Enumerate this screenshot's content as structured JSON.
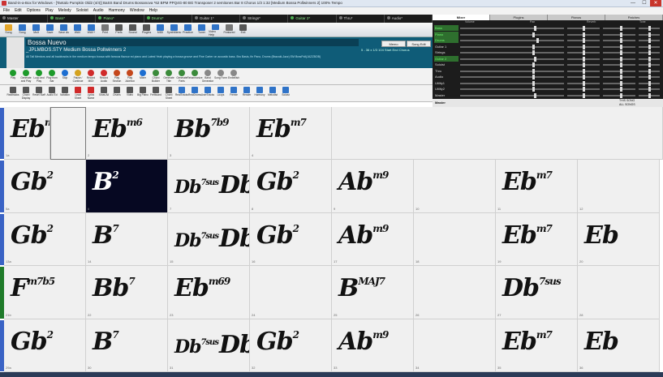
{
  "window": {
    "title": "Band-in-a-Box for Windows - [Tantalo Pumpkin Old2 (4/4)] BaSS Band Drums Bossanova *62 BPM PPQ4G-80 BG Transposer 2 semitones Bar 8 Chorus 1/3  1:32  [Medium Bossa Pollwinners 2] 100% Tempo",
    "min": "—",
    "max": "☐",
    "close": "✕"
  },
  "menu": [
    "File",
    "Edit",
    "Options",
    "Play",
    "Melody",
    "Soloist",
    "Audio",
    "Harmony",
    "Window",
    "Help"
  ],
  "tracks": [
    {
      "label": "Master",
      "on": false
    },
    {
      "label": "Bass*",
      "on": true
    },
    {
      "label": "Piano*",
      "on": true
    },
    {
      "label": "Drums*",
      "on": true
    },
    {
      "label": "Guitar 1*",
      "on": false
    },
    {
      "label": "Strings*",
      "on": false
    },
    {
      "label": "Guitar 2*",
      "on": true
    },
    {
      "label": "Thru*",
      "on": false
    },
    {
      "label": "Audio*",
      "on": false
    }
  ],
  "toolbar": [
    {
      "label": "Song",
      "color": "#e4a62b"
    },
    {
      "label": "Song",
      "color": "#2f73c8"
    },
    {
      "label": "Mult",
      "color": "#2f73c8"
    },
    {
      "label": "Save",
      "color": "#2f73c8"
    },
    {
      "label": "Save As",
      "color": "#2f73c8"
    },
    {
      "label": "WAV",
      "color": "#2f73c8"
    },
    {
      "label": "WAV+",
      "color": "#2f73c8"
    },
    {
      "label": "Print",
      "color": "#777777"
    },
    {
      "label": "Prefs",
      "color": "#555555"
    },
    {
      "label": "Sound",
      "color": "#555555"
    },
    {
      "label": "Plugins",
      "color": "#555555"
    },
    {
      "label": "MIDI",
      "color": "#2f73c8"
    },
    {
      "label": "SynthMenu",
      "color": "#2f73c8"
    },
    {
      "label": "Practice",
      "color": "#2f73c8"
    },
    {
      "label": "Tuner",
      "color": "#2f73c8"
    },
    {
      "label": "Video Help",
      "color": "#2f73c8"
    },
    {
      "label": "Featured",
      "color": "#777777"
    },
    {
      "label": "Exit",
      "color": "#555555"
    }
  ],
  "song": {
    "title": "Bossa Nuevo",
    "style": "_JPLMBOS.STY Medium Bossa Pollwinners 2",
    "memo": "All Tall Mentors and all backtracks in the medium tempo bossa with famous flavour ed piano and Latest Yeah playing a bossa groove and Fine Carter on acoustic bass.   Bru Basis, fin Pano, Drums (Brazuki-Jazz) EM BrasPoll(JAZZBOB)",
    "counters": "5 - 36 x 1/3  104  Start End Chorus",
    "side1": "Memo",
    "side2": "Song Edit"
  },
  "controls_row1": [
    {
      "label": "Play",
      "color": "#1d9a2a"
    },
    {
      "label": "Generate and Play",
      "color": "#1d9a2a"
    },
    {
      "label": "Loop and Play",
      "color": "#1d9a2a"
    },
    {
      "label": "Play from Bar",
      "color": "#1d9a2a"
    },
    {
      "label": "Stop",
      "color": "#1d6ed1"
    },
    {
      "label": "Pause / Continue",
      "color": "#d4a21f"
    },
    {
      "label": "Record MIDI",
      "color": "#d02a2a"
    },
    {
      "label": "Record Audio",
      "color": "#d02a2a"
    },
    {
      "label": "Play Section",
      "color": "#c4471c"
    },
    {
      "label": "Play Jukebox",
      "color": "#c4471c"
    },
    {
      "label": "Mixer",
      "color": "#1d6ed1"
    },
    {
      "label": "Chord Builder",
      "color": "#3a8a3a"
    },
    {
      "label": "Generate Title",
      "color": "#3a8a3a"
    },
    {
      "label": "Generate Parts",
      "color": "#3a8a3a"
    },
    {
      "label": "Reharmonize",
      "color": "#3a8a3a"
    },
    {
      "label": "Band Generator",
      "color": "#888888"
    },
    {
      "label": "Song Form",
      "color": "#888888"
    },
    {
      "label": "Embellish",
      "color": "#888888"
    }
  ],
  "controls_row2": [
    {
      "label": "Realtracks",
      "color": "#555555"
    },
    {
      "label": "Chord Display",
      "color": "#555555"
    },
    {
      "label": "Reset Staff",
      "color": "#555555"
    },
    {
      "label": "Audio Ed",
      "color": "#555555"
    },
    {
      "label": "Notation",
      "color": "#555555"
    },
    {
      "label": "Lead Sheet",
      "color": "#d02a2a"
    },
    {
      "label": "Lyrics Name",
      "color": "#d02a2a"
    },
    {
      "label": "Show All",
      "color": "#555555"
    },
    {
      "label": "Drums",
      "color": "#555555"
    },
    {
      "label": "Video",
      "color": "#555555"
    },
    {
      "label": "Big Piano",
      "color": "#555555"
    },
    {
      "label": "Fretboard",
      "color": "#555555"
    },
    {
      "label": "Chord Sheet",
      "color": "#555555"
    },
    {
      "label": "RealTracks",
      "color": "#2f73c8"
    },
    {
      "label": "RealDrums",
      "color": "#2f73c8"
    },
    {
      "label": "UserTracks",
      "color": "#2f73c8"
    },
    {
      "label": "Loops",
      "color": "#2f73c8"
    },
    {
      "label": "Freeze",
      "color": "#2f73c8"
    },
    {
      "label": "Render",
      "color": "#2f73c8"
    },
    {
      "label": "Harmony",
      "color": "#2f73c8"
    },
    {
      "label": "Melodist",
      "color": "#2f73c8"
    },
    {
      "label": "Soloist",
      "color": "#2f73c8"
    }
  ],
  "mixer": {
    "tabs": [
      "Mixer",
      "Plugins",
      "Pianos",
      "Patches"
    ],
    "headers": [
      "Volume",
      "Pan",
      "Reverb",
      "Tone"
    ],
    "channels": [
      {
        "name": "Bass",
        "hi": true,
        "vol": 0.72,
        "pan": 0.5,
        "rev": 0.55,
        "tone": 0.5
      },
      {
        "name": "Piano",
        "hi": true,
        "vol": 0.7,
        "pan": 0.5,
        "rev": 0.55,
        "tone": 0.5
      },
      {
        "name": "Drums",
        "hi": true,
        "vol": 0.74,
        "pan": 0.5,
        "rev": 0.55,
        "tone": 0.5
      },
      {
        "name": "Guitar 1",
        "hi": false,
        "vol": 0.7,
        "pan": 0.5,
        "rev": 0.55,
        "tone": 0.5
      },
      {
        "name": "Strings",
        "hi": false,
        "vol": 0.7,
        "pan": 0.5,
        "rev": 0.55,
        "tone": 0.5
      },
      {
        "name": "Guitar 2",
        "hi": true,
        "vol": 0.72,
        "pan": 0.5,
        "rev": 0.55,
        "tone": 0.5
      },
      {
        "name": "Soloist",
        "hi": false,
        "vol": 0.7,
        "pan": 0.5,
        "rev": 0.55,
        "tone": 0.5
      },
      {
        "name": "Thru",
        "hi": false,
        "vol": 0.7,
        "pan": 0.5,
        "rev": 0.55,
        "tone": 0.5
      },
      {
        "name": "Audio",
        "hi": false,
        "vol": 0.7,
        "pan": 0.5,
        "rev": 0.55,
        "tone": 0.5
      },
      {
        "name": "Utility1",
        "hi": false,
        "vol": 0.7,
        "pan": 0.5,
        "rev": 0.55,
        "tone": 0.5
      },
      {
        "name": "Utility2",
        "hi": false,
        "vol": 0.7,
        "pan": 0.5,
        "rev": 0.55,
        "tone": 0.5
      },
      {
        "name": "Master",
        "hi": false,
        "vol": 0.72,
        "pan": 0.5,
        "rev": 0.55,
        "tone": 0.5
      }
    ],
    "bottom_master": "Master",
    "this_song": "THIS SONG",
    "all_songs": "ALL SONGS"
  },
  "rows": [
    {
      "marker": "blue",
      "cells": [
        {
          "num": "1a",
          "chord": "Eb",
          "ext": "m"
        },
        {
          "num": "",
          "chord": "",
          "ext": "",
          "sel": true
        },
        {
          "num": "2",
          "chord": "Eb",
          "ext": "m6"
        },
        {
          "num": "3",
          "chord": "Bb",
          "ext": "7b9"
        },
        {
          "num": "4",
          "chord": "Eb",
          "ext": "m7"
        }
      ]
    },
    {
      "marker": "blue",
      "cells": [
        {
          "num": "5a",
          "chord": "Gb",
          "ext": "2"
        },
        {
          "num": "6",
          "chord": "B",
          "ext": "2",
          "hl": true
        },
        {
          "num": "7",
          "chord": "Db",
          "ext": "7sus",
          "chord2": "Db",
          "ext2": "7"
        },
        {
          "num": "8",
          "chord": "Gb",
          "ext": "2"
        },
        {
          "num": "9",
          "chord": "Ab",
          "ext": "m9"
        },
        {
          "num": "10",
          "chord": "",
          "ext": ""
        },
        {
          "num": "11",
          "chord": "Eb",
          "ext": "m7"
        },
        {
          "num": "12",
          "chord": "",
          "ext": ""
        }
      ]
    },
    {
      "marker": "blue",
      "cells": [
        {
          "num": "13a",
          "chord": "Gb",
          "ext": "2"
        },
        {
          "num": "14",
          "chord": "B",
          "ext": "7"
        },
        {
          "num": "15",
          "chord": "Db",
          "ext": "7sus",
          "chord2": "Db",
          "ext2": "7"
        },
        {
          "num": "16",
          "chord": "Gb",
          "ext": "2"
        },
        {
          "num": "17",
          "chord": "Ab",
          "ext": "m9"
        },
        {
          "num": "18",
          "chord": "",
          "ext": ""
        },
        {
          "num": "19",
          "chord": "Eb",
          "ext": "m7"
        },
        {
          "num": "20",
          "chord": "Eb",
          "ext": ""
        }
      ]
    },
    {
      "marker": "green",
      "cells": [
        {
          "num": "21b",
          "chord": "F",
          "ext": "m7b5"
        },
        {
          "num": "22",
          "chord": "Bb",
          "ext": "7"
        },
        {
          "num": "23",
          "chord": "Eb",
          "ext": "m69"
        },
        {
          "num": "24",
          "chord": "",
          "ext": ""
        },
        {
          "num": "25",
          "chord": "B",
          "ext": "MAJ7"
        },
        {
          "num": "26",
          "chord": "",
          "ext": ""
        },
        {
          "num": "27",
          "chord": "Db",
          "ext": "7sus"
        },
        {
          "num": "28",
          "chord": "",
          "ext": ""
        }
      ]
    },
    {
      "marker": "blue",
      "cells": [
        {
          "num": "29a",
          "chord": "Gb",
          "ext": "2"
        },
        {
          "num": "30",
          "chord": "B",
          "ext": "7"
        },
        {
          "num": "31",
          "chord": "Db",
          "ext": "7sus",
          "chord2": "Db",
          "ext2": "7"
        },
        {
          "num": "32",
          "chord": "Gb",
          "ext": "2"
        },
        {
          "num": "33",
          "chord": "Ab",
          "ext": "m9"
        },
        {
          "num": "34",
          "chord": "",
          "ext": ""
        },
        {
          "num": "35",
          "chord": "Eb",
          "ext": "m7"
        },
        {
          "num": "36",
          "chord": "Eb",
          "ext": ""
        }
      ]
    }
  ]
}
